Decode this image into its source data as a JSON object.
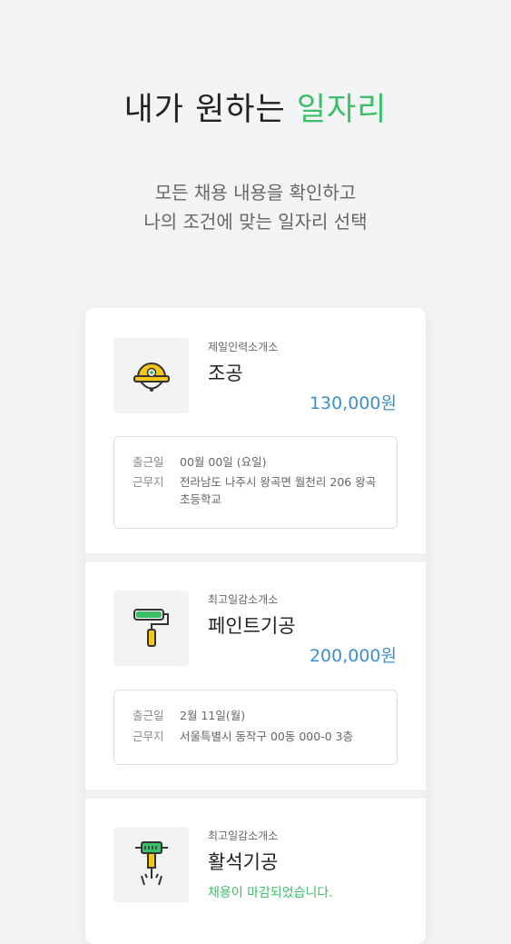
{
  "hero": {
    "title_main": "내가 원하는 ",
    "title_accent": "일자리",
    "subtitle_line1": "모든 채용 내용을 확인하고",
    "subtitle_line2": "나의 조건에 맞는 일자리 선택"
  },
  "labels": {
    "date": "출근일",
    "place": "근무지"
  },
  "jobs": [
    {
      "company": "제일인력소개소",
      "title": "조공",
      "pay": "130,000원",
      "date": "00월 00일 (요일)",
      "place": "전라남도 나주시 왕곡면 월천리 206 왕곡 초등학교",
      "icon": "hard-hat-icon"
    },
    {
      "company": "최고일감소개소",
      "title": "페인트기공",
      "pay": "200,000원",
      "date": "2월 11일(월)",
      "place": "서울특별시 동작구 00동 000-0 3층",
      "icon": "paint-roller-icon"
    },
    {
      "company": "최고일감소개소",
      "title": "활석기공",
      "status": "채용이 마감되었습니다.",
      "icon": "jackhammer-icon"
    }
  ],
  "colors": {
    "accent_green": "#3dbf6a",
    "pay_blue": "#3c8fd0",
    "background": "#f2f4f5"
  }
}
